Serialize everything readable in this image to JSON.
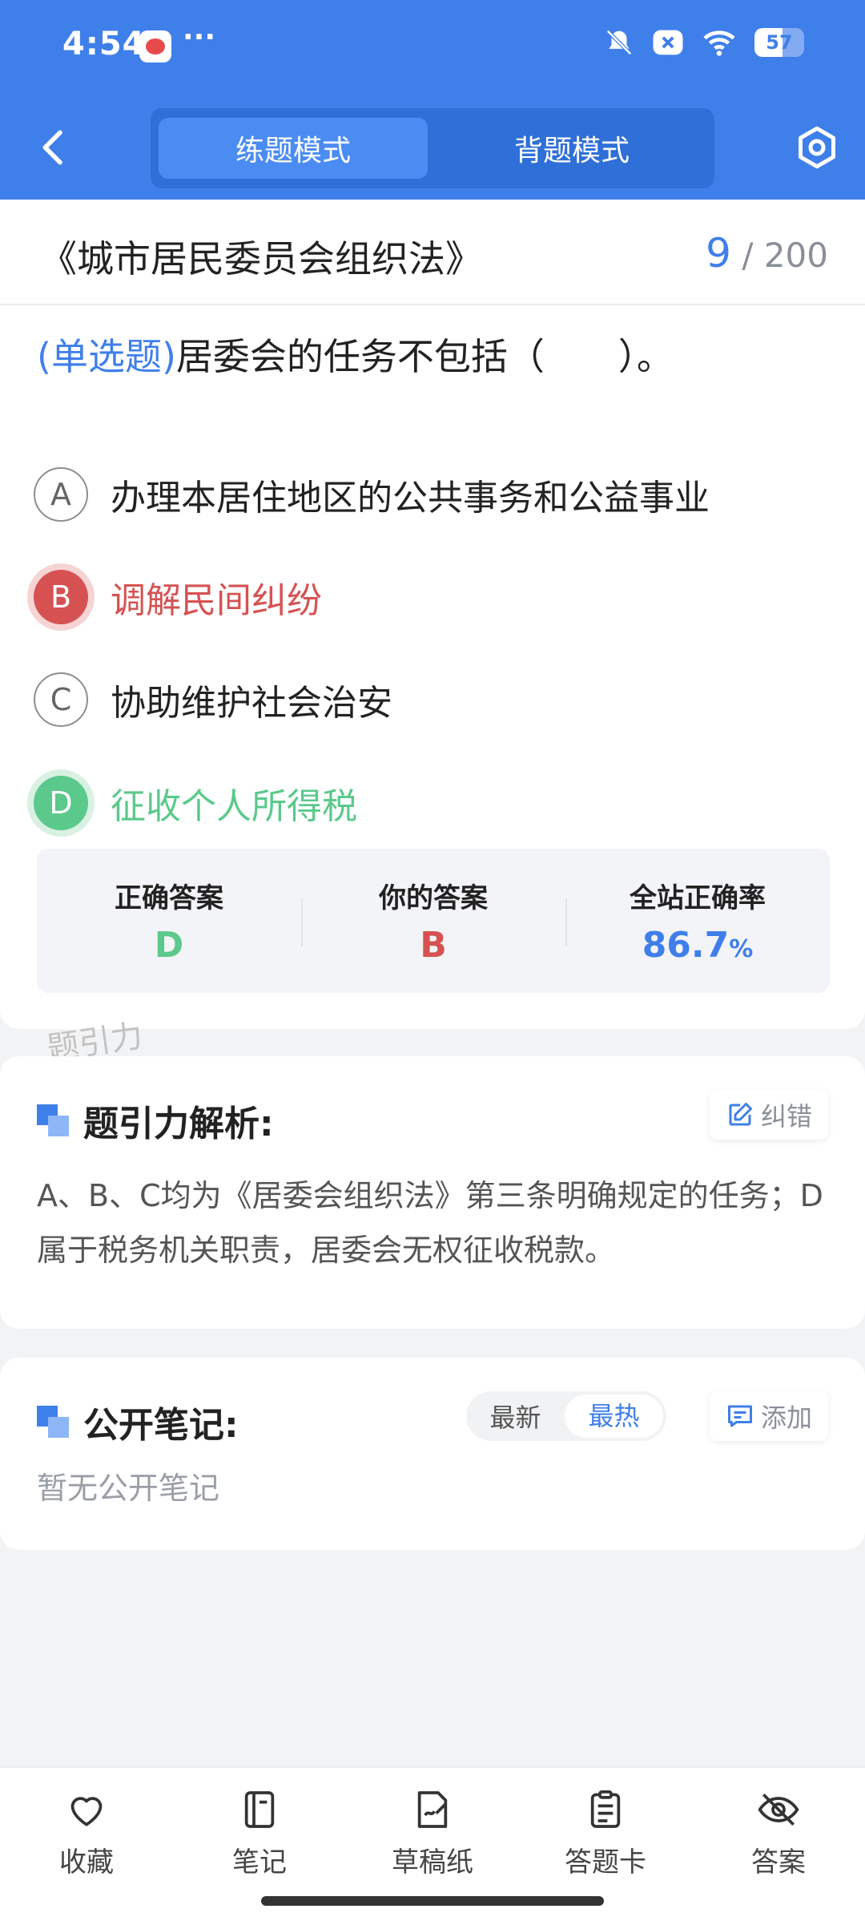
{
  "status_bar": {
    "time": "4:54",
    "more": "···",
    "battery": "57"
  },
  "nav": {
    "modes": [
      "练题模式",
      "背题模式"
    ],
    "active_mode": "练题模式"
  },
  "question": {
    "book_title": "《城市居民委员会组织法》",
    "current_index": "9",
    "total": "/ 200",
    "type": "(单选题)",
    "text": "居委会的任务不包括（　　）。",
    "options": [
      {
        "letter": "A",
        "text": "办理本居住地区的公共事务和公益事业",
        "state": "normal"
      },
      {
        "letter": "B",
        "text": "调解民间纠纷",
        "state": "wrong"
      },
      {
        "letter": "C",
        "text": "协助维护社会治安",
        "state": "normal"
      },
      {
        "letter": "D",
        "text": "征收个人所得税",
        "state": "correct"
      }
    ]
  },
  "answer_panel": {
    "correct_label": "正确答案",
    "correct_value": "D",
    "user_label": "你的答案",
    "user_value": "B",
    "rate_label": "全站正确率",
    "rate_value": "86.7",
    "rate_unit": "%"
  },
  "watermark": "题引力",
  "analysis": {
    "title": "题引力解析:",
    "correction_label": "纠错",
    "text": "A、B、C均为《居委会组织法》第三条明确规定的任务；D属于税务机关职责，居委会无权征收税款。"
  },
  "notes": {
    "title": "公开笔记:",
    "sort_options": [
      "最新",
      "最热"
    ],
    "active_sort": "最热",
    "add_label": "添加",
    "empty_text": "暂无公开笔记"
  },
  "bottom_bar": [
    {
      "label": "收藏",
      "icon": "heart-icon"
    },
    {
      "label": "笔记",
      "icon": "notebook-icon"
    },
    {
      "label": "草稿纸",
      "icon": "draft-paper-icon"
    },
    {
      "label": "答题卡",
      "icon": "answer-card-icon"
    },
    {
      "label": "答案",
      "icon": "eye-off-icon"
    }
  ],
  "colors": {
    "primary": "#3f7fea",
    "wrong": "#d65252",
    "correct": "#5bc98b"
  }
}
